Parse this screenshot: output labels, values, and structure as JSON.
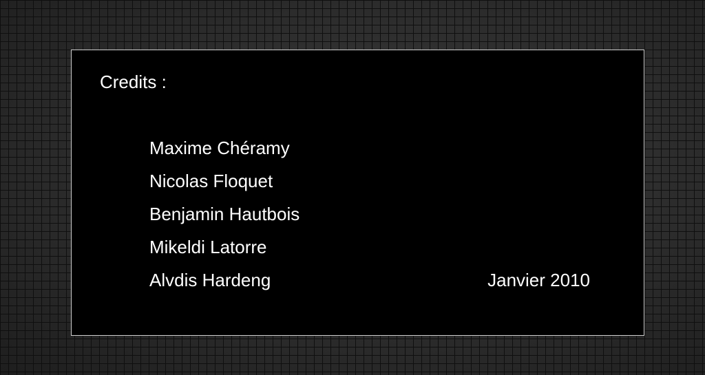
{
  "credits": {
    "title": "Credits :",
    "names": [
      "Maxime Chéramy",
      "Nicolas Floquet",
      "Benjamin Hautbois",
      "Mikeldi Latorre",
      "Alvdis Hardeng"
    ],
    "date": "Janvier 2010"
  },
  "colors": {
    "panel_background": "#000000",
    "panel_border": "#cfcfcf",
    "text": "#ffffff",
    "backdrop": "#2a2a2a",
    "backdrop_grid": "#0f0f0f"
  }
}
